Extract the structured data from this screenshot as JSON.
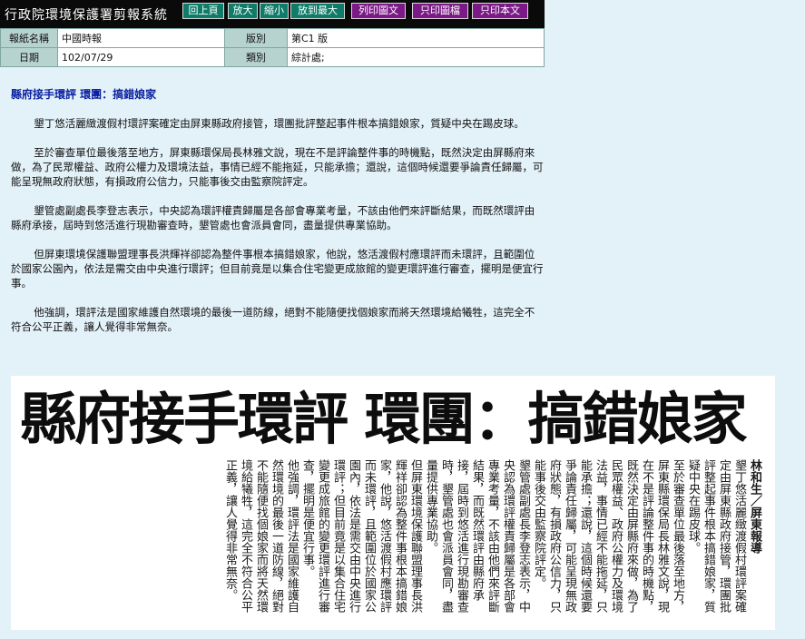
{
  "toolbar": {
    "system_title": "行政院環境保護署剪報系統",
    "buttons": {
      "back": "回上頁",
      "zoom_in": "放大",
      "zoom_out": "縮小",
      "zoom_max": "放到最大",
      "print_text_image": "列印圖文",
      "print_image": "只印圖檔",
      "print_text": "只印本文"
    }
  },
  "meta": {
    "paper_label": "報紙名稱",
    "paper_value": "中國時報",
    "edition_label": "版別",
    "edition_value": "第C1 版",
    "date_label": "日期",
    "date_value": "102/07/29",
    "category_label": "類別",
    "category_value": "綜計處;"
  },
  "article": {
    "headline": "縣府接手環評 環團：搞錯娘家",
    "paragraphs": [
      "墾丁悠活麗緻渡假村環評案確定由屏東縣政府接管，環團批評整起事件根本搞錯娘家，質疑中央在踢皮球。",
      "至於審查單位最後落至地方，屏東縣環保局長林雅文說，現在不是評論整件事的時機點，既然決定由屏縣府來做，為了民眾權益、政府公權力及環境法益，事情已經不能拖延，只能承擔；還說，這個時候還要爭論責任歸屬，可能呈現無政府狀態，有損政府公信力，只能事後交由監察院評定。",
      "墾管處副處長李登志表示，中央認為環評權責歸屬是各部會專業考量，不該由他們來評斷結果，而既然環評由縣府承接，屆時到悠活進行現勘審查時，墾管處也會派員會同，盡量提供專業協助。",
      "但屏東環境保護聯盟理事長洪輝祥卻認為整件事根本搞錯娘家，他說，悠活渡假村應環評而未環評，且範圍位於國家公園內，依法是需交由中央進行環評；但目前竟是以集合住宅變更成旅館的變更環評進行審查，擺明是便宜行事。",
      "他強調，環評法是國家維護自然環境的最後一道防線，絕對不能隨便找個娘家而將天然環境給犧牲，這完全不符合公平正義，讓人覺得非常無奈。"
    ]
  },
  "clipping": {
    "title": "縣府接手環評 環團：搞錯娘家",
    "byline": "林和生／屏東報導"
  }
}
